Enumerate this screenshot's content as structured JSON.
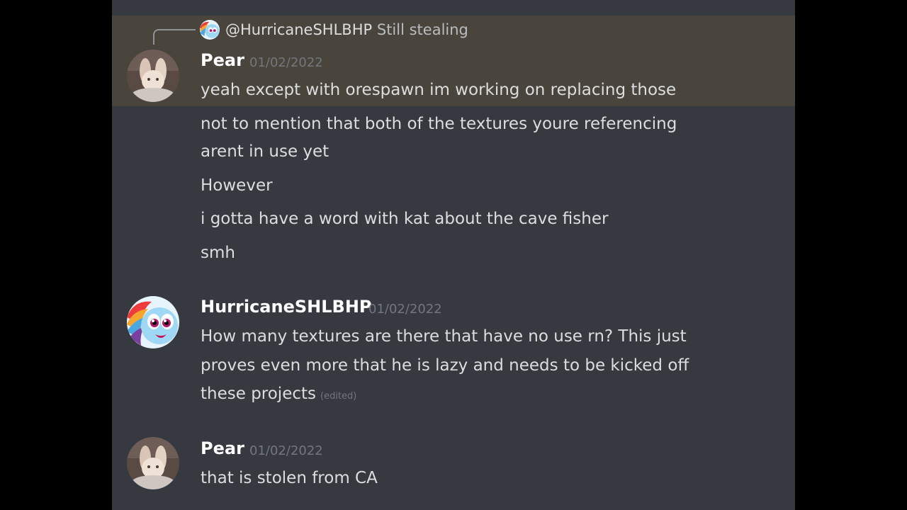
{
  "reply": {
    "mention": "@HurricaneSHLBHP",
    "text": "Still stealing"
  },
  "messages": [
    {
      "author": "Pear",
      "timestamp": "01/02/2022",
      "lines": [
        "yeah except with orespawn im working on replacing those",
        "not to mention that both of the textures youre referencing",
        "arent in use yet",
        "However",
        "i gotta have a word with kat about the cave fisher",
        "smh"
      ]
    },
    {
      "author": "HurricaneSHLBHP",
      "timestamp": "01/02/2022",
      "lines": [
        "How many textures are there that have no use rn? This just",
        "proves even more that he is lazy and needs to be kicked off",
        "these projects"
      ],
      "edited_label": "(edited)"
    },
    {
      "author": "Pear",
      "timestamp": "01/02/2022",
      "lines": [
        "that is stolen from CA"
      ]
    }
  ],
  "colors": {
    "background": "#36393f",
    "highlight": "#49443c",
    "username": "#ffffff",
    "timestamp": "#72767d",
    "text": "#dcddde"
  },
  "icons": {
    "pear_avatar": "bunny-photo-avatar",
    "hurricane_avatar": "rainbow-pony-avatar"
  }
}
